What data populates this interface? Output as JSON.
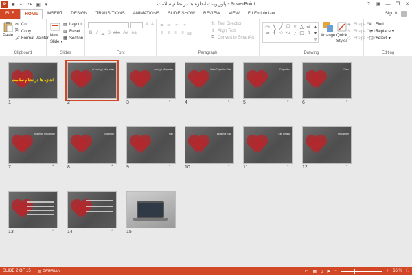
{
  "window": {
    "title": "پاورپوینت اندازه ها در نظام سلامت - PowerPoint",
    "logo": "P",
    "qat": [
      {
        "icon": "save-icon",
        "glyph": "■"
      },
      {
        "icon": "undo-icon",
        "glyph": "↶"
      },
      {
        "icon": "redo-icon",
        "glyph": "↷"
      },
      {
        "icon": "start-from-beginning-icon",
        "glyph": "▣"
      },
      {
        "icon": "customize-qat-icon",
        "glyph": "▾"
      }
    ],
    "controls": [
      "?",
      "▣",
      "—",
      "❐",
      "✕"
    ]
  },
  "tabs": [
    "FILE",
    "HOME",
    "INSERT",
    "DESIGN",
    "TRANSITIONS",
    "ANIMATIONS",
    "SLIDE SHOW",
    "REVIEW",
    "VIEW",
    "FILEminimizer"
  ],
  "active_tab": "HOME",
  "signin": "Sign in",
  "ribbon": {
    "clipboard": {
      "label": "Clipboard",
      "paste": "Paste",
      "cut": "Cut",
      "copy": "Copy",
      "format_painter": "Format Painter"
    },
    "slides": {
      "label": "Slides",
      "new_slide": "New",
      "new_slide2": "Slide",
      "layout": "Layout",
      "reset": "Reset",
      "section": "Section"
    },
    "font": {
      "label": "Font",
      "buttons": [
        "B",
        "I",
        "U",
        "S",
        "abc",
        "AV",
        "Aa",
        "A",
        "A"
      ]
    },
    "paragraph": {
      "label": "Paragraph",
      "text_direction": "Text Direction",
      "align_text": "Align Text",
      "convert_smartart": "Convert to SmartArt"
    },
    "drawing": {
      "label": "Drawing",
      "arrange": "Arrange",
      "quick_styles": "Quick",
      "quick_styles2": "Styles",
      "shape_fill": "Shape Fill",
      "shape_outline": "Shape Outline",
      "shape_effects": "Shape Effects"
    },
    "editing": {
      "label": "Editing",
      "find": "Find",
      "replace": "Replace",
      "select": "Select"
    }
  },
  "slides": [
    {
      "n": "1",
      "star": "",
      "title": "اندازه ها در نظام سلامت"
    },
    {
      "n": "2",
      "star": "",
      "text": "مقاله بیانگر این است که"
    },
    {
      "n": "3",
      "star": "*",
      "text": "مقاله بیانگر این است"
    },
    {
      "n": "4",
      "star": "*",
      "text": "Ratio Proportion Rate"
    },
    {
      "n": "5",
      "star": "*",
      "text": "Proportion"
    },
    {
      "n": "6",
      "star": "*",
      "text": "Ratio"
    },
    {
      "n": "7",
      "star": "*",
      "text": "Incidence Prevalence"
    },
    {
      "n": "8",
      "star": "*",
      "text": "Incidence"
    },
    {
      "n": "9",
      "star": "*",
      "text": "Risk"
    },
    {
      "n": "10",
      "star": "*",
      "text": "Incidence Rate"
    },
    {
      "n": "11",
      "star": "*",
      "text": "City Deaths"
    },
    {
      "n": "12",
      "star": "*",
      "text": "Prevalence"
    },
    {
      "n": "13",
      "star": "*",
      "text": ""
    },
    {
      "n": "14",
      "star": "*",
      "text": ""
    },
    {
      "n": "15",
      "star": "",
      "text": ""
    }
  ],
  "status": {
    "slide_of": "SLIDE 2 OF 15",
    "language": "PERSIAN",
    "zoom": "66 %",
    "zoom_value": 0.66
  },
  "colors": {
    "accent": "#d24726",
    "heart": "#b3272d",
    "title_yellow": "#ffd700"
  }
}
